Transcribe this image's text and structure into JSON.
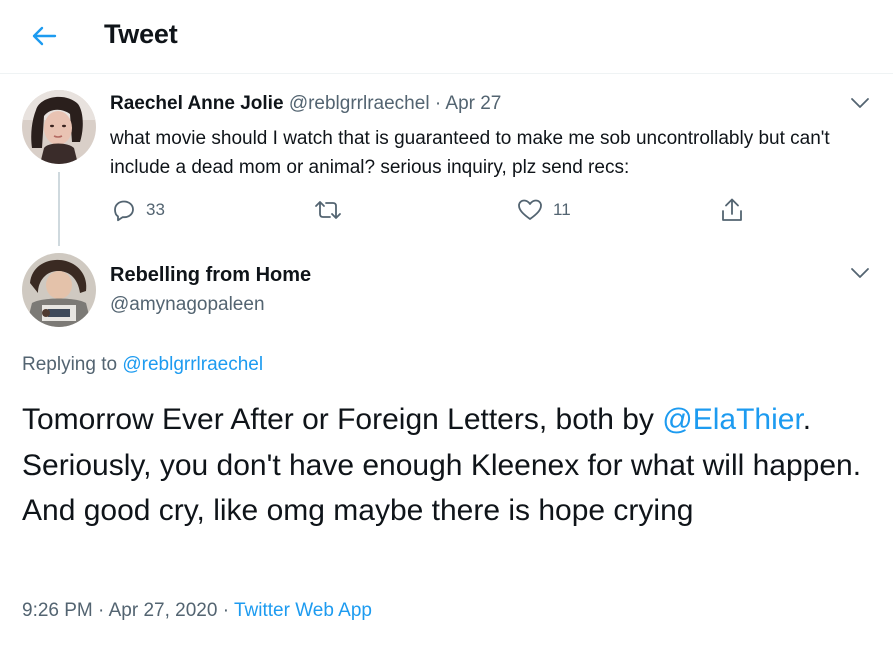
{
  "colors": {
    "accent": "#1d9bf0",
    "text_primary": "#0f1419",
    "text_secondary": "#536471",
    "divider": "#eff3f4",
    "thread_line": "#cfd9de"
  },
  "header": {
    "back_icon": "arrow-left-icon",
    "title": "Tweet"
  },
  "parent_tweet": {
    "display_name": "Raechel Anne Jolie",
    "handle": "@reblgrrlraechel",
    "separator": "·",
    "date": "Apr 27",
    "text": "what movie should I watch that is guaranteed to make me sob uncontrollably but can't include a dead mom or animal? serious inquiry, plz send recs:",
    "menu_icon": "chevron-down-icon",
    "actions": {
      "reply": {
        "icon": "reply-icon",
        "count": "33"
      },
      "retweet": {
        "icon": "retweet-icon",
        "count": ""
      },
      "like": {
        "icon": "heart-icon",
        "count": "11"
      },
      "share": {
        "icon": "share-icon"
      }
    }
  },
  "reply_tweet": {
    "display_name": "Rebelling from Home",
    "handle": "@amynagopaleen",
    "menu_icon": "chevron-down-icon",
    "replying_prefix": "Replying to",
    "replying_to": "@reblgrrlraechel",
    "text_before": "Tomorrow Ever After or Foreign Letters, both by",
    "mention": "@ElaThier",
    "text_after": ". Seriously, you don't have enough Kleenex for what will happen.  And good cry, like omg maybe there is hope crying",
    "time": "9:26 PM",
    "meta_sep": "·",
    "date": "Apr 27, 2020",
    "source_sep": "·",
    "source": "Twitter Web App"
  }
}
